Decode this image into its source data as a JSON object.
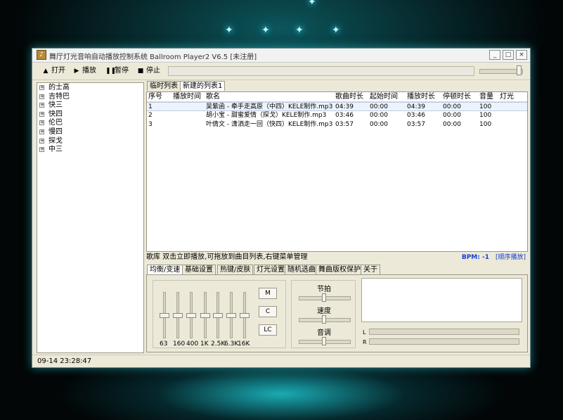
{
  "window": {
    "title": "舞厅灯光音响自动播放控制系统 Ballroom Player2 V6.5 [未注册]"
  },
  "winbuttons": {
    "min": "_",
    "max": "□",
    "close": "×"
  },
  "toolbar": {
    "open": "打开",
    "play": "播放",
    "pause": "暂停",
    "stop": "停止"
  },
  "playback": {
    "volume_fraction": 0.95
  },
  "tree": [
    "的士高",
    "吉特巴",
    "快三",
    "快四",
    "伦巴",
    "慢四",
    "探戈",
    "中三"
  ],
  "playlist_tabs": [
    "临时列表",
    "新建的列表1"
  ],
  "columns": [
    "序号",
    "播放时间",
    "歌名",
    "歌曲时长",
    "起始时间",
    "播放时长",
    "停顿时长",
    "音量",
    "灯光"
  ],
  "rows": [
    {
      "idx": "1",
      "play_time": "",
      "name": "吴紫函 - 牵手走高原（中四）KELE制作.mp3",
      "duration": "04:39",
      "start": "00:00",
      "play_len": "04:39",
      "pause": "00:00",
      "volume": "100",
      "light": ""
    },
    {
      "idx": "2",
      "play_time": "",
      "name": "胡小宝 - 甜蜜爱情（探戈）KELE制作.mp3",
      "duration": "03:46",
      "start": "00:00",
      "play_len": "03:46",
      "pause": "00:00",
      "volume": "100",
      "light": ""
    },
    {
      "idx": "3",
      "play_time": "",
      "name": "叶倩文 - 潇洒走一回（快四）KELE制作.mp3",
      "duration": "03:57",
      "start": "00:00",
      "play_len": "03:57",
      "pause": "00:00",
      "volume": "100",
      "light": ""
    }
  ],
  "status": {
    "hint": "歌库 双击立即播放,可拖放到曲目列表,右键菜单管理",
    "bpm": "BPM: -1",
    "mode": "[顺序播放]"
  },
  "bottom_tabs": [
    "均衡/变速",
    "基础设置",
    "热键/皮肤",
    "灯光设置",
    "随机选曲",
    "舞曲版权保护",
    "关于"
  ],
  "eq": {
    "bands": [
      "63",
      "160",
      "400",
      "1K",
      "2.5K",
      "6.3K",
      "16K"
    ],
    "levels": [
      0.5,
      0.5,
      0.5,
      0.5,
      0.5,
      0.5,
      0.5
    ],
    "buttons": [
      "M",
      "C",
      "LC"
    ]
  },
  "rhythm": {
    "labels": [
      "节拍",
      "速度",
      "音调"
    ],
    "levels": [
      0.5,
      0.5,
      0.5
    ]
  },
  "meters": {
    "left": "L",
    "right": "R"
  },
  "footer": {
    "datetime": "09-14 23:28:47"
  }
}
